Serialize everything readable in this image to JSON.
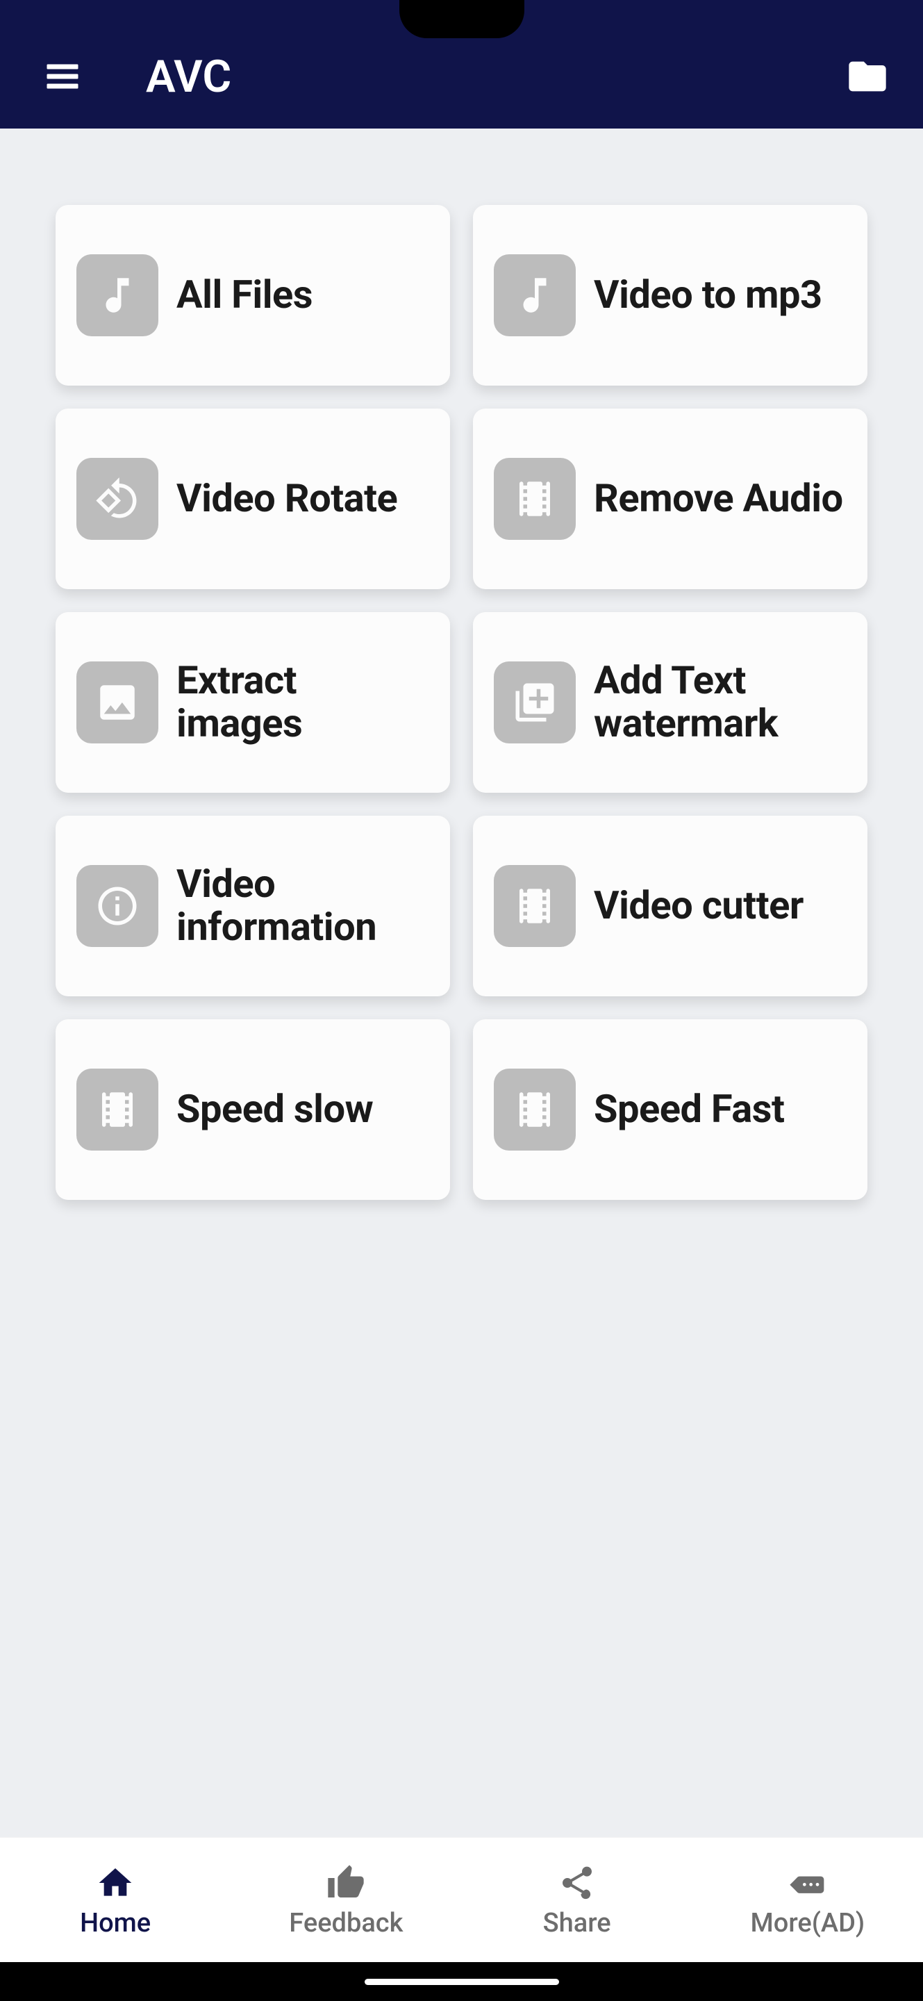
{
  "header": {
    "title": "AVC"
  },
  "tools": [
    {
      "id": "all-files",
      "label": "All Files",
      "icon": "music"
    },
    {
      "id": "video-to-mp3",
      "label": "Video to mp3",
      "icon": "music"
    },
    {
      "id": "video-rotate",
      "label": "Video Rotate",
      "icon": "rotate"
    },
    {
      "id": "remove-audio",
      "label": "Remove Audio",
      "icon": "film"
    },
    {
      "id": "extract-images",
      "label": "Extract images",
      "icon": "image"
    },
    {
      "id": "add-watermark",
      "label": "Add Text watermark",
      "icon": "add-layer"
    },
    {
      "id": "video-info",
      "label": "Video information",
      "icon": "info"
    },
    {
      "id": "video-cutter",
      "label": "Video cutter",
      "icon": "film"
    },
    {
      "id": "speed-slow",
      "label": "Speed slow",
      "icon": "film"
    },
    {
      "id": "speed-fast",
      "label": "Speed Fast",
      "icon": "film"
    }
  ],
  "nav": {
    "home": "Home",
    "feedback": "Feedback",
    "share": "Share",
    "more": "More(AD)",
    "active": "home"
  }
}
